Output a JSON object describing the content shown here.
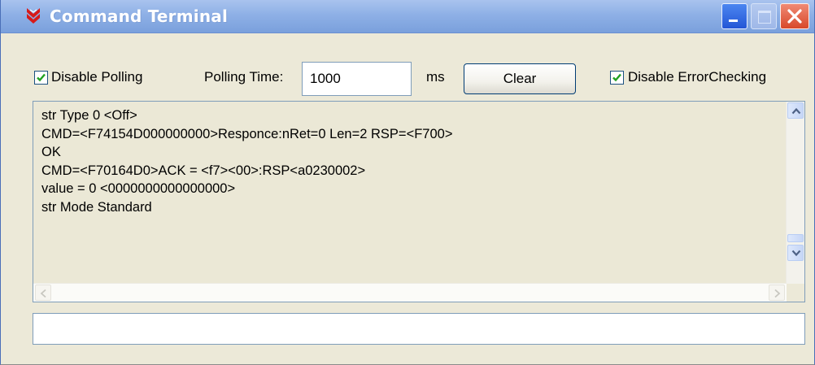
{
  "window": {
    "title": "Command Terminal",
    "icon": "red-chevron-logo-icon",
    "controls": [
      "minimize-icon",
      "maximize-icon",
      "close-icon"
    ]
  },
  "toolbar": {
    "disable_polling": {
      "label": "Disable Polling",
      "checked": true
    },
    "polling_time_label": "Polling Time:",
    "polling_time_value": "1000",
    "polling_unit": "ms",
    "clear_label": "Clear",
    "disable_error_checking": {
      "label": "Disable ErrorChecking",
      "checked": true
    }
  },
  "output": {
    "lines": [
      "str Type 0 <Off>",
      "CMD=<F74154D000000000>Responce:nRet=0 Len=2 RSP=<F700>",
      "OK",
      "CMD=<F70164D0>ACK = <f7><00>:RSP<a0230002>",
      "value = 0 <0000000000000000>",
      "str Mode Standard"
    ]
  },
  "command_input": {
    "value": ""
  },
  "colors": {
    "titlebar": "#8eb0e6",
    "window_face": "#ece9d8",
    "close_button": "#d8482a",
    "minimize_button": "#2356d6",
    "logo": "#d71a1a"
  }
}
